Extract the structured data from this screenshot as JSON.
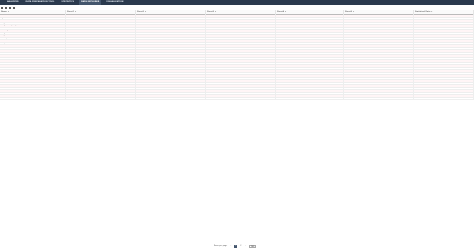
{
  "nav": {
    "tabs": [
      {
        "label": "ANALYZER"
      },
      {
        "label": "DATA PREPARATION TOOL"
      },
      {
        "label": "STATISTICS"
      },
      {
        "label": "DATA EXPLORER"
      },
      {
        "label": "VISUALIZATION"
      }
    ],
    "active_index": 3
  },
  "table": {
    "columns": [
      "Name",
      "Sheet1",
      "Sheet2",
      "Sheet3",
      "Sheet4",
      "Sheet5",
      "Statistical Data"
    ],
    "rows": [
      [
        "Patient ID",
        "Date of admission",
        "Date of admission",
        "Date of admission",
        "",
        "",
        ""
      ],
      [
        "Age at admission",
        "Numeric value",
        "",
        "",
        "",
        "",
        ""
      ],
      [
        "Gender",
        "",
        "",
        "",
        "",
        "",
        ""
      ],
      [
        "Diagnosis code",
        "Text",
        "Text",
        "Text",
        "",
        "",
        ""
      ],
      [
        "Length of stay (days)",
        "",
        "",
        "",
        "",
        "",
        ""
      ],
      [
        "Ward",
        "",
        "",
        "",
        "",
        "",
        ""
      ],
      [
        "Discharge status",
        "",
        "",
        "",
        "",
        "",
        ""
      ],
      [
        "Weight",
        "",
        "",
        "",
        "",
        "",
        ""
      ],
      [
        "Height",
        "",
        "",
        "",
        "",
        "",
        ""
      ],
      [
        "Blood pressure",
        "",
        "",
        "",
        "",
        "",
        ""
      ],
      [
        "Heart rate",
        "",
        "",
        "",
        "",
        "",
        ""
      ],
      [
        "Temperature",
        "",
        "",
        "",
        "",
        "",
        ""
      ],
      [
        "",
        "",
        "",
        "",
        "",
        "",
        ""
      ],
      [
        "",
        "",
        "",
        "",
        "",
        "",
        ""
      ],
      [
        "",
        "",
        "",
        "",
        "",
        "",
        ""
      ],
      [
        "",
        "",
        "",
        "",
        "",
        "",
        ""
      ],
      [
        "",
        "",
        "",
        "",
        "",
        "",
        ""
      ],
      [
        "",
        "",
        "",
        "",
        "",
        "",
        ""
      ],
      [
        "",
        "",
        "",
        "",
        "",
        "",
        ""
      ],
      [
        "",
        "",
        "",
        "",
        "",
        "",
        ""
      ],
      [
        "",
        "",
        "",
        "",
        "",
        "",
        ""
      ],
      [
        "",
        "",
        "",
        "",
        "",
        "",
        ""
      ],
      [
        "",
        "",
        "",
        "",
        "",
        "",
        ""
      ],
      [
        "",
        "",
        "",
        "",
        "",
        "",
        ""
      ],
      [
        "",
        "",
        "",
        "",
        "",
        "",
        ""
      ],
      [
        "",
        "",
        "",
        "",
        "",
        "",
        ""
      ],
      [
        "",
        "",
        "",
        "",
        "",
        "",
        ""
      ],
      [
        "",
        "",
        "",
        "",
        "",
        "",
        ""
      ],
      [
        "",
        "",
        "",
        "",
        "",
        "",
        ""
      ],
      [
        "",
        "",
        "",
        "",
        "",
        "",
        ""
      ],
      [
        "",
        "",
        "",
        "",
        "",
        "",
        ""
      ],
      [
        "",
        "",
        "",
        "",
        "",
        "",
        ""
      ],
      [
        "",
        "",
        "",
        "",
        "",
        "",
        ""
      ],
      [
        "",
        "",
        "",
        "",
        "",
        "",
        ""
      ]
    ]
  },
  "pager": {
    "label": "Rows per page",
    "prev": "‹",
    "pages": [
      "1",
      "2"
    ],
    "current": "1",
    "next": "›",
    "size": "100"
  },
  "colors": {
    "topbar": "#2b3a4e",
    "active_tab": "#44566d",
    "row_alt": "#fff5f6"
  }
}
